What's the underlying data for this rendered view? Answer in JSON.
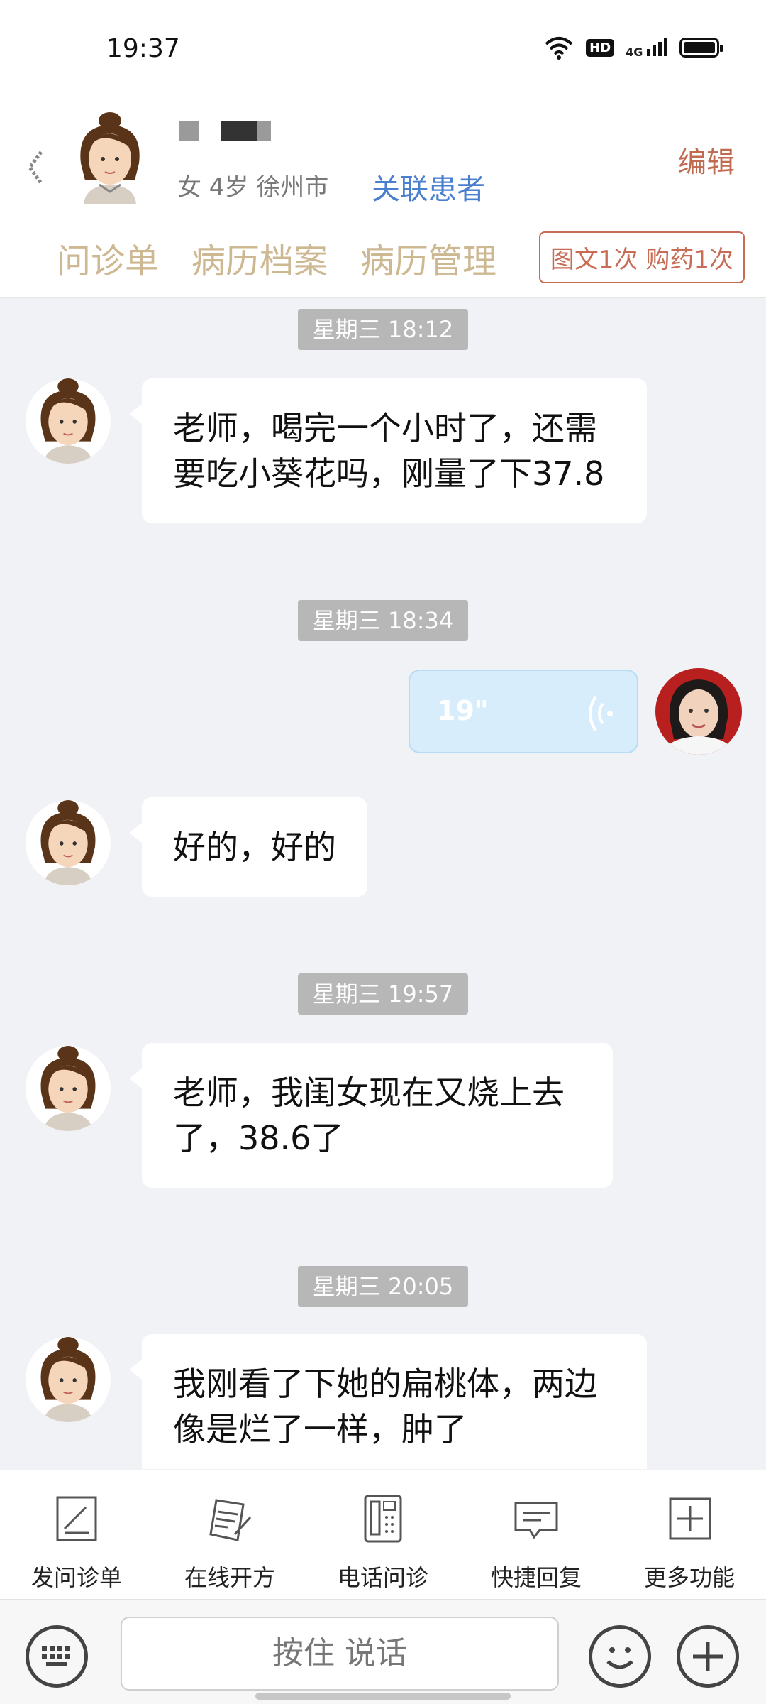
{
  "status_bar": {
    "time": "19:37",
    "hd_label": "HD",
    "network_label": "4G"
  },
  "header": {
    "patient_info": "女 4岁  徐州市",
    "link_patient": "关联患者",
    "edit": "编辑",
    "tabs": [
      "问诊单",
      "病历档案",
      "病历管理"
    ],
    "service_badge": "图文1次 购药1次"
  },
  "messages": [
    {
      "type": "timestamp",
      "text": "星期三 18:12"
    },
    {
      "type": "incoming",
      "text": "老师，喝完一个小时了，还需要吃小葵花吗，刚量了下37.8"
    },
    {
      "type": "timestamp",
      "text": "星期三 18:34"
    },
    {
      "type": "outgoing-voice",
      "duration": "19\""
    },
    {
      "type": "incoming",
      "text": "好的，好的"
    },
    {
      "type": "timestamp",
      "text": "星期三 19:57"
    },
    {
      "type": "incoming",
      "text": "老师，我闺女现在又烧上去了，38.6了"
    },
    {
      "type": "timestamp",
      "text": "星期三 20:05"
    },
    {
      "type": "incoming",
      "text": "我刚看了下她的扁桃体，两边像是烂了一样，肿了"
    }
  ],
  "toolbar": [
    {
      "label": "发问诊单",
      "icon": "form-icon"
    },
    {
      "label": "在线开方",
      "icon": "prescription-icon"
    },
    {
      "label": "电话问诊",
      "icon": "phone-icon"
    },
    {
      "label": "快捷回复",
      "icon": "quick-reply-icon"
    },
    {
      "label": "更多功能",
      "icon": "more-icon"
    }
  ],
  "input": {
    "hold_to_talk": "按住 说话"
  }
}
